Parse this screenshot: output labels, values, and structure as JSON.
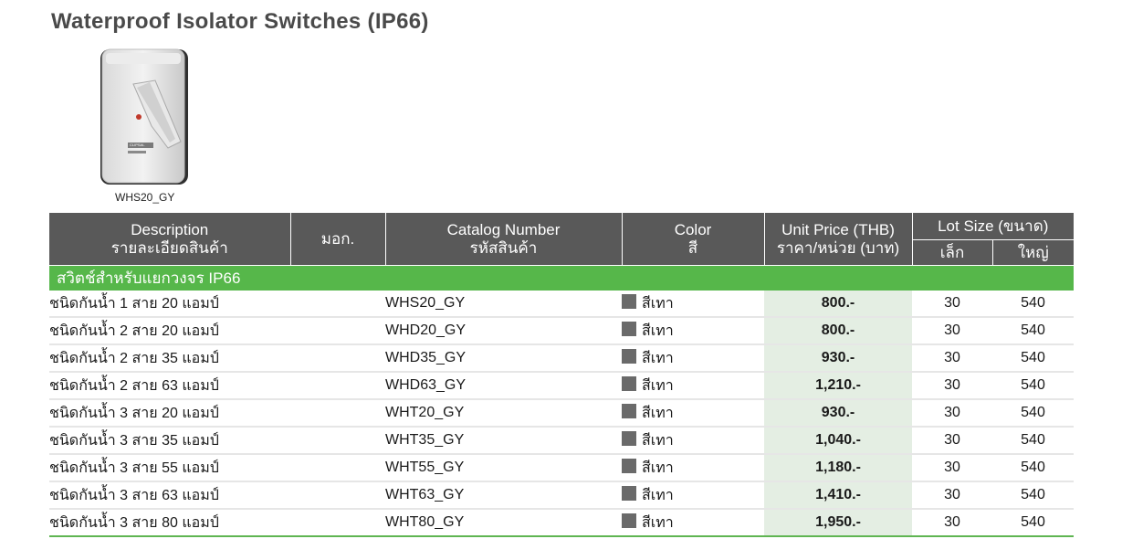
{
  "page": {
    "title": "Waterproof Isolator Switches (IP66)",
    "product_image_caption": "WHS20_GY",
    "product_image_label": "CLIPSAL"
  },
  "table": {
    "headers": {
      "description_en": "Description",
      "description_th": "รายละเอียดสินค้า",
      "standard": "มอก.",
      "catalog_en": "Catalog Number",
      "catalog_th": "รหัสสินค้า",
      "color_en": "Color",
      "color_th": "สี",
      "price_en": "Unit Price (THB)",
      "price_th": "ราคา/หน่วย (บาท)",
      "lot_size": "Lot Size (ขนาด)",
      "lot_small": "เล็ก",
      "lot_large": "ใหญ่"
    },
    "category": "สวิตช์สำหรับแยกวงจร IP66",
    "rows": [
      {
        "description": "ชนิดกันน้ำ 1 สาย 20 แอมป์",
        "standard": "",
        "catalog": "WHS20_GY",
        "color": "สีเทา",
        "price": "800.-",
        "lot_small": "30",
        "lot_large": "540"
      },
      {
        "description": "ชนิดกันน้ำ 2 สาย 20 แอมป์",
        "standard": "",
        "catalog": "WHD20_GY",
        "color": "สีเทา",
        "price": "800.-",
        "lot_small": "30",
        "lot_large": "540"
      },
      {
        "description": "ชนิดกันน้ำ 2 สาย 35 แอมป์",
        "standard": "",
        "catalog": "WHD35_GY",
        "color": "สีเทา",
        "price": "930.-",
        "lot_small": "30",
        "lot_large": "540"
      },
      {
        "description": "ชนิดกันน้ำ 2 สาย 63 แอมป์",
        "standard": "",
        "catalog": "WHD63_GY",
        "color": "สีเทา",
        "price": "1,210.-",
        "lot_small": "30",
        "lot_large": "540"
      },
      {
        "description": "ชนิดกันน้ำ 3 สาย 20 แอมป์",
        "standard": "",
        "catalog": "WHT20_GY",
        "color": "สีเทา",
        "price": "930.-",
        "lot_small": "30",
        "lot_large": "540"
      },
      {
        "description": "ชนิดกันน้ำ 3 สาย 35 แอมป์",
        "standard": "",
        "catalog": "WHT35_GY",
        "color": "สีเทา",
        "price": "1,040.-",
        "lot_small": "30",
        "lot_large": "540"
      },
      {
        "description": "ชนิดกันน้ำ 3 สาย 55 แอมป์",
        "standard": "",
        "catalog": "WHT55_GY",
        "color": "สีเทา",
        "price": "1,180.-",
        "lot_small": "30",
        "lot_large": "540"
      },
      {
        "description": "ชนิดกันน้ำ 3 สาย 63 แอมป์",
        "standard": "",
        "catalog": "WHT63_GY",
        "color": "สีเทา",
        "price": "1,410.-",
        "lot_small": "30",
        "lot_large": "540"
      },
      {
        "description": "ชนิดกันน้ำ 3 สาย 80 แอมป์",
        "standard": "",
        "catalog": "WHT80_GY",
        "color": "สีเทา",
        "price": "1,950.-",
        "lot_small": "30",
        "lot_large": "540"
      }
    ]
  },
  "colors": {
    "header_bg": "#595959",
    "category_bg": "#56b74a",
    "price_bg": "#e4eee3",
    "swatch_gray": "#6a6a6a"
  },
  "icons": {
    "color_swatch": "gray-square"
  }
}
